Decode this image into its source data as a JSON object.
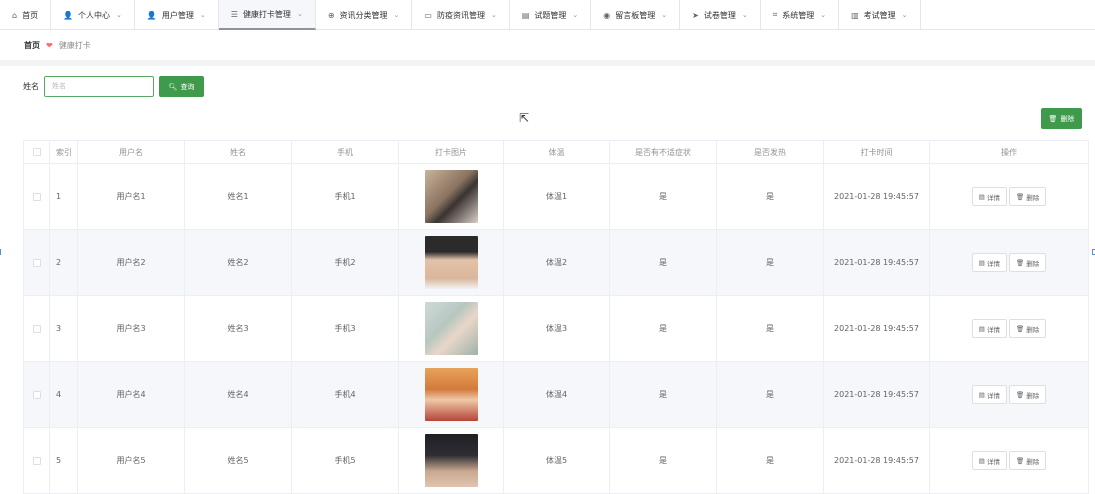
{
  "nav": [
    {
      "icon": "⌂",
      "label": "首页",
      "chevron": false,
      "active": false
    },
    {
      "icon": "👤",
      "label": "个人中心",
      "chevron": true,
      "active": false
    },
    {
      "icon": "👤",
      "label": "用户管理",
      "chevron": true,
      "active": false
    },
    {
      "icon": "☰",
      "label": "健康打卡管理",
      "chevron": true,
      "active": true
    },
    {
      "icon": "⊕",
      "label": "资讯分类管理",
      "chevron": true,
      "active": false
    },
    {
      "icon": "▭",
      "label": "防疫资讯管理",
      "chevron": true,
      "active": false
    },
    {
      "icon": "▤",
      "label": "试题管理",
      "chevron": true,
      "active": false
    },
    {
      "icon": "◉",
      "label": "留言板管理",
      "chevron": true,
      "active": false
    },
    {
      "icon": "➤",
      "label": "试卷管理",
      "chevron": true,
      "active": false
    },
    {
      "icon": "⌗",
      "label": "系统管理",
      "chevron": true,
      "active": false
    },
    {
      "icon": "▥",
      "label": "考试管理",
      "chevron": true,
      "active": false
    }
  ],
  "breadcrumb": {
    "home": "首页",
    "separator": "❤",
    "current": "健康打卡"
  },
  "search": {
    "label": "姓名",
    "placeholder": "姓名",
    "button_label": "查询"
  },
  "toolbar": {
    "delete_label": "删除"
  },
  "table": {
    "headers": [
      "",
      "索引",
      "用户名",
      "姓名",
      "手机",
      "打卡图片",
      "体温",
      "是否有不适症状",
      "是否发热",
      "打卡时间",
      "操作"
    ],
    "detail_label": "详情",
    "delete_label": "删除",
    "rows": [
      {
        "index": "1",
        "username": "用户名1",
        "name": "姓名1",
        "phone": "手机1",
        "temp": "体温1",
        "symptom": "是",
        "fever": "是",
        "time": "2021-01-28 19:45:57"
      },
      {
        "index": "2",
        "username": "用户名2",
        "name": "姓名2",
        "phone": "手机2",
        "temp": "体温2",
        "symptom": "是",
        "fever": "是",
        "time": "2021-01-28 19:45:57"
      },
      {
        "index": "3",
        "username": "用户名3",
        "name": "姓名3",
        "phone": "手机3",
        "temp": "体温3",
        "symptom": "是",
        "fever": "是",
        "time": "2021-01-28 19:45:57"
      },
      {
        "index": "4",
        "username": "用户名4",
        "name": "姓名4",
        "phone": "手机4",
        "temp": "体温4",
        "symptom": "是",
        "fever": "是",
        "time": "2021-01-28 19:45:57"
      },
      {
        "index": "5",
        "username": "用户名5",
        "name": "姓名5",
        "phone": "手机5",
        "temp": "体温5",
        "symptom": "是",
        "fever": "是",
        "time": "2021-01-28 19:45:57"
      }
    ]
  },
  "colors": {
    "accent": "#3f9a4b",
    "stripe": "#f5f7fa",
    "border": "#ebeef5"
  }
}
